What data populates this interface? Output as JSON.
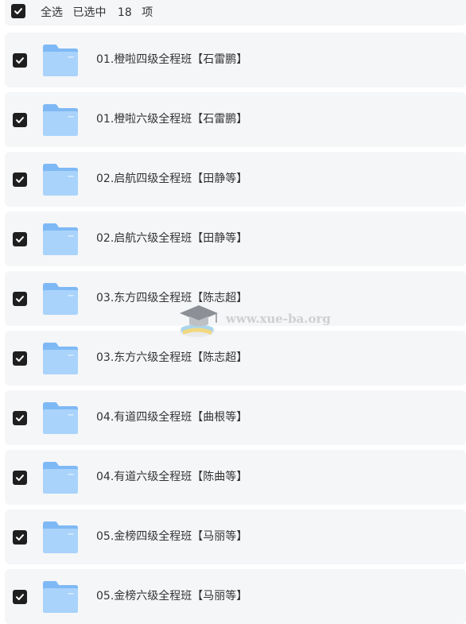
{
  "header": {
    "select_all_label": "全选",
    "selected_prefix": "已选中",
    "selected_count": "18",
    "selected_suffix": "项"
  },
  "files": [
    {
      "name": "01.橙啦四级全程班【石雷鹏】"
    },
    {
      "name": "01.橙啦六级全程班【石雷鹏】"
    },
    {
      "name": "02.启航四级全程班【田静等】"
    },
    {
      "name": "02.启航六级全程班【田静等】"
    },
    {
      "name": "03.东方四级全程班【陈志超】"
    },
    {
      "name": "03.东方六级全程班【陈志超】"
    },
    {
      "name": "04.有道四级全程班【曲根等】"
    },
    {
      "name": "04.有道六级全程班【陈曲等】"
    },
    {
      "name": "05.金榜四级全程班【马丽等】"
    },
    {
      "name": "05.金榜六级全程班【马丽等】"
    }
  ],
  "watermark": {
    "text": "www.xue-ba.org"
  },
  "colors": {
    "row_background": "#f5f6f8",
    "checkbox": "#1f1f1f",
    "folder_back": "#7fb9f5",
    "folder_front": "#a9d3fb",
    "text": "#333333"
  },
  "icons": {
    "checkbox": "checkbox-checked-icon",
    "folder": "folder-icon"
  }
}
